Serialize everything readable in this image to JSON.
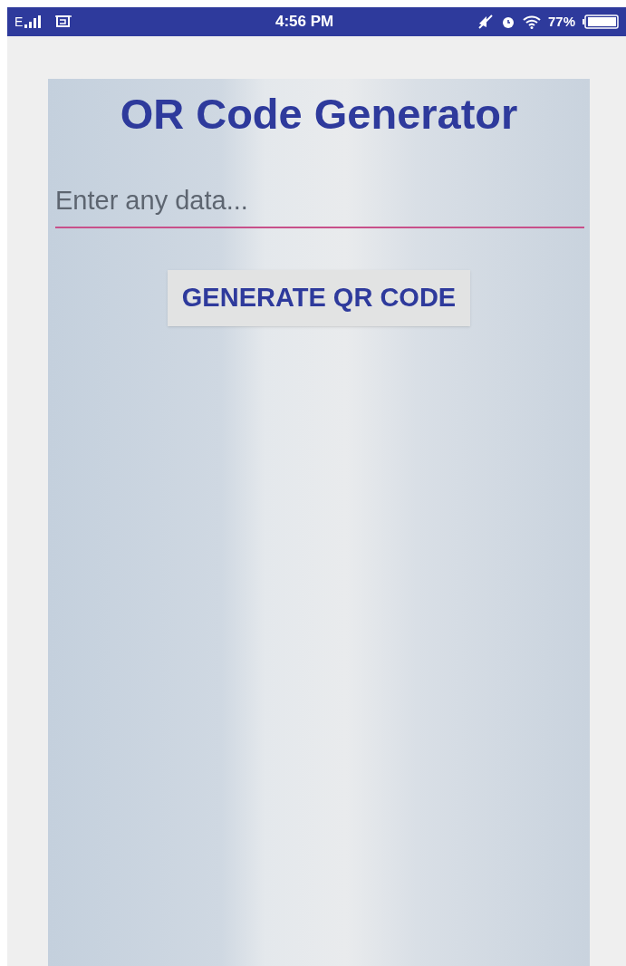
{
  "status_bar": {
    "network": "E",
    "time": "4:56 PM",
    "battery": "77%"
  },
  "app": {
    "title": "OR Code Generator",
    "input": {
      "placeholder": "Enter any data..."
    },
    "button": "GENERATE QR CODE"
  }
}
